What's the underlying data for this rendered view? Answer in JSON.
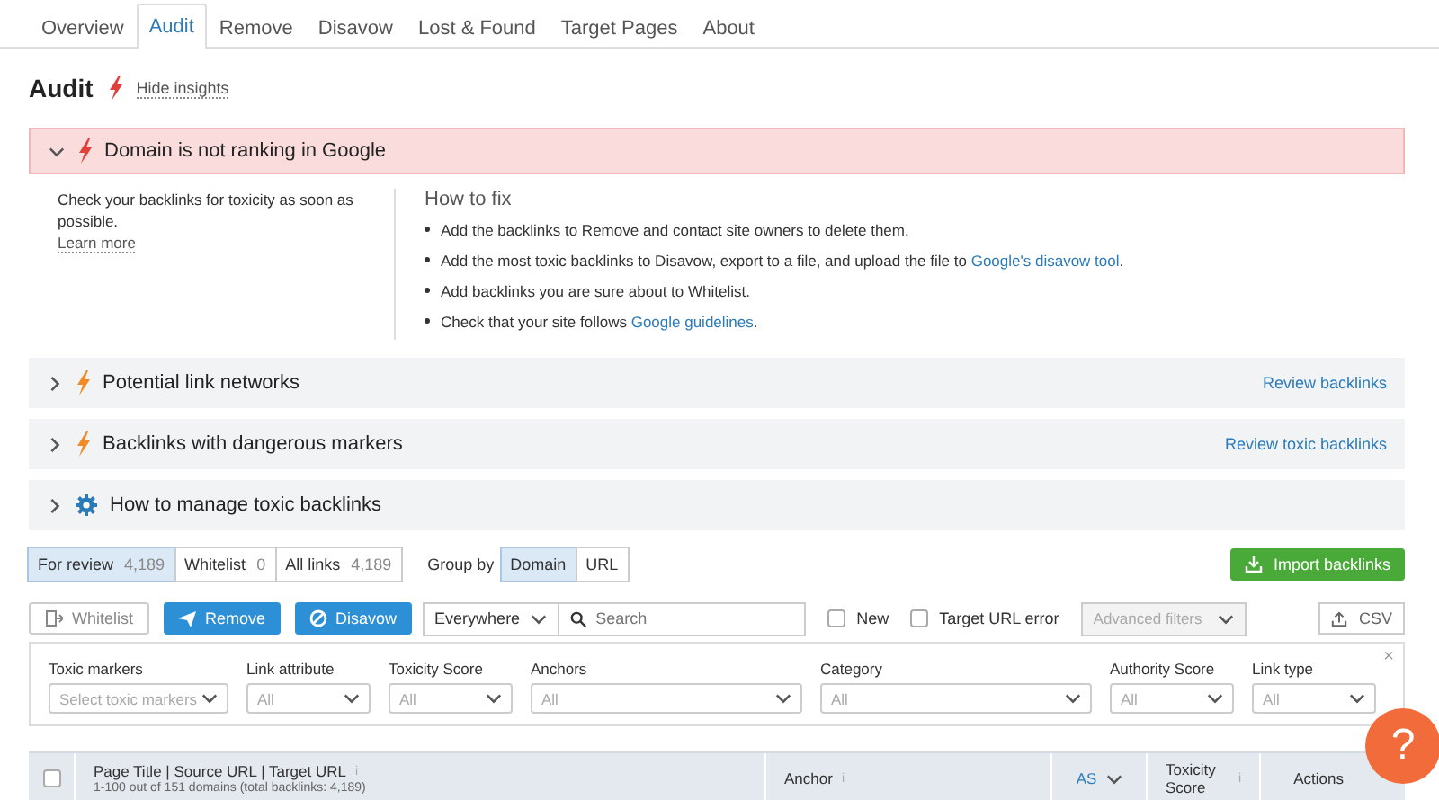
{
  "tabs": [
    {
      "label": "Overview",
      "selected": false
    },
    {
      "label": "Audit",
      "selected": true
    },
    {
      "label": "Remove",
      "selected": false
    },
    {
      "label": "Disavow",
      "selected": false
    },
    {
      "label": "Lost & Found",
      "selected": false
    },
    {
      "label": "Target Pages",
      "selected": false
    },
    {
      "label": "About",
      "selected": false
    }
  ],
  "page_title": "Audit",
  "insights_toggle": "Hide insights",
  "insights": [
    {
      "kind": "critical",
      "title": "Domain is not ranking in Google",
      "expanded": true,
      "summary": "Check your backlinks for toxicity as soon as possible.",
      "learn_more": "Learn more",
      "how_to_fix": "How to fix",
      "steps": [
        {
          "text": "Add the backlinks to Remove and contact site owners to delete them."
        },
        {
          "text": "Add the most toxic backlinks to Disavow, export to a file, and upload the file to ",
          "link": "Google's disavow tool",
          "after": "."
        },
        {
          "text": "Add backlinks you are sure about to Whitelist."
        },
        {
          "text": "Check that your site follows ",
          "link": "Google guidelines",
          "after": "."
        }
      ]
    },
    {
      "kind": "warning",
      "title": "Potential link networks",
      "expanded": false,
      "action": "Review backlinks"
    },
    {
      "kind": "warning",
      "title": "Backlinks with dangerous markers",
      "expanded": false,
      "action": "Review toxic backlinks"
    },
    {
      "kind": "info",
      "title": "How to manage toxic backlinks",
      "expanded": false
    }
  ],
  "view_tabs": [
    {
      "label": "For review",
      "count": "4,189",
      "selected": true
    },
    {
      "label": "Whitelist",
      "count": "0",
      "selected": false
    },
    {
      "label": "All links",
      "count": "4,189",
      "selected": false
    }
  ],
  "group_by": {
    "label": "Group by",
    "options": [
      {
        "label": "Domain",
        "selected": true
      },
      {
        "label": "URL",
        "selected": false
      }
    ]
  },
  "import_button": "Import backlinks",
  "toolbar": {
    "buttons": [
      {
        "kind": "whitelist",
        "label": "Whitelist"
      },
      {
        "kind": "remove",
        "label": "Remove"
      },
      {
        "kind": "disavow",
        "label": "Disavow"
      }
    ],
    "scope": "Everywhere",
    "search_placeholder": "Search",
    "checkboxes": [
      {
        "label": "New",
        "checked": false
      },
      {
        "label": "Target URL error",
        "checked": false
      }
    ],
    "advanced_filters": "Advanced filters",
    "export": "CSV"
  },
  "filters": [
    {
      "label": "Toxic markers",
      "placeholder": "Select toxic markers"
    },
    {
      "label": "Link attribute",
      "placeholder": "All"
    },
    {
      "label": "Toxicity Score",
      "placeholder": "All"
    },
    {
      "label": "Anchors",
      "placeholder": "All"
    },
    {
      "label": "Category",
      "placeholder": "All"
    },
    {
      "label": "Authority Score",
      "placeholder": "All"
    },
    {
      "label": "Link type",
      "placeholder": "All"
    }
  ],
  "filters_close": "×",
  "table": {
    "select_all": {
      "checked": false
    },
    "columns": [
      {
        "label": "Page Title | Source URL | Target URL",
        "info": "i",
        "subtitle": "1-100 out of 151 domains (total backlinks: 4,189)"
      },
      {
        "label": "Anchor",
        "info": "i"
      },
      {
        "label": "AS",
        "sorted": true
      },
      {
        "label": "Toxicity Score",
        "info": "i"
      },
      {
        "label": "Actions"
      }
    ]
  },
  "help_button": "?"
}
